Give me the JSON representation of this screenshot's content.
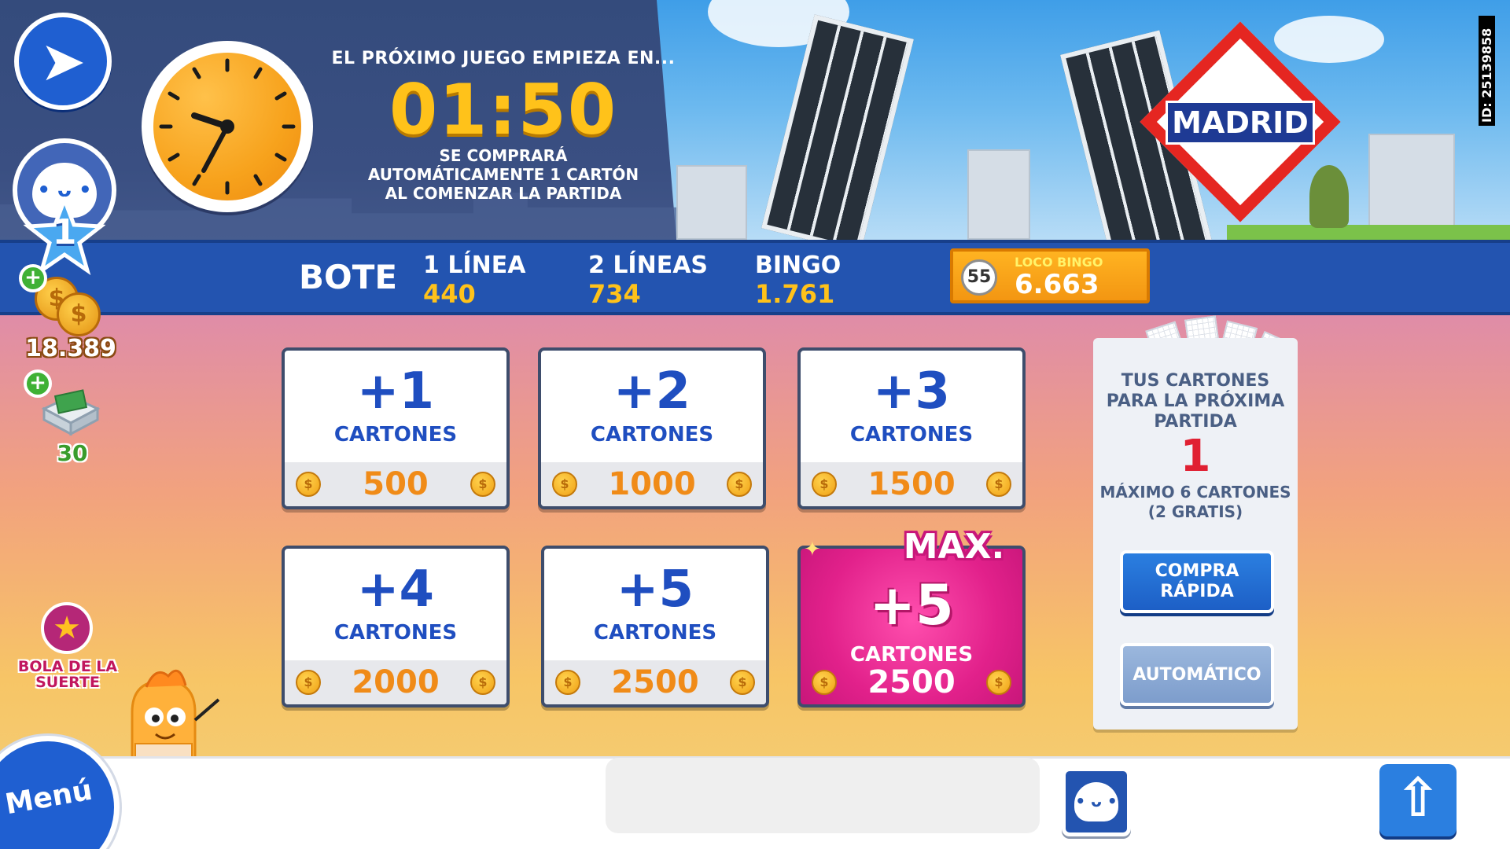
{
  "header": {
    "next_game_label": "EL PRÓXIMO JUEGO EMPIEZA EN...",
    "countdown": "01:50",
    "auto_buy_line1": "SE COMPRARÁ",
    "auto_buy_line2": "AUTOMÁTICAMENTE 1 CARTÓN",
    "auto_buy_line3": "AL COMENZAR LA PARTIDA",
    "city_sign": "MADRID",
    "game_id": "ID: 25139858"
  },
  "player": {
    "level": "1",
    "coins": "18.389",
    "tickets": "30",
    "plus_symbol": "+"
  },
  "prizes": {
    "pot_label": "BOTE",
    "items": [
      {
        "name": "1 LÍNEA",
        "value": "440"
      },
      {
        "name": "2 LÍNEAS",
        "value": "734"
      },
      {
        "name": "BINGO",
        "value": "1.761"
      }
    ],
    "loco_bingo": {
      "ball": "55",
      "title": "LOCO BINGO",
      "value": "6.663"
    }
  },
  "cards": [
    {
      "amount": "+1",
      "unit": "CARTONES",
      "price": "500"
    },
    {
      "amount": "+2",
      "unit": "CARTONES",
      "price": "1000"
    },
    {
      "amount": "+3",
      "unit": "CARTONES",
      "price": "1500"
    },
    {
      "amount": "+4",
      "unit": "CARTONES",
      "price": "2000"
    },
    {
      "amount": "+5",
      "unit": "CARTONES",
      "price": "2500"
    },
    {
      "label": "MAX.",
      "amount": "+5",
      "unit": "CARTONES",
      "price": "2500"
    }
  ],
  "coin_symbol": "$",
  "info_panel": {
    "title_line1": "TUS CARTONES",
    "title_line2": "PARA LA PRÓXIMA",
    "title_line3": "PARTIDA",
    "count": "1",
    "max_line1": "MÁXIMO 6 CARTONES",
    "max_line2": "(2 GRATIS)",
    "quick_buy_line1": "COMPRA",
    "quick_buy_line2": "RÁPIDA",
    "auto_label": "AUTOMÁTICO"
  },
  "lucky_ball": {
    "line1": "BOLA DE LA",
    "line2": "SUERTE"
  },
  "bottom": {
    "menu_label": "Menú",
    "chat_placeholder": ""
  },
  "icons": {
    "back": "arrow-left-icon",
    "up": "arrow-up-icon",
    "clock": "clock-icon",
    "star": "star-icon",
    "coin": "coin-icon"
  },
  "colors": {
    "primary_blue": "#1f5fd1",
    "gold": "#ffc21a",
    "orange_price": "#f08b18",
    "pink_max": "#e2218b",
    "red_count": "#e02032"
  }
}
